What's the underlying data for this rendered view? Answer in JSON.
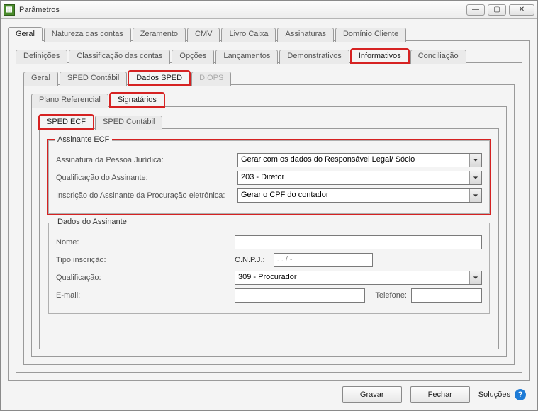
{
  "window": {
    "title": "Parâmetros"
  },
  "tabs_level1": {
    "geral": "Geral",
    "natureza": "Natureza das contas",
    "zeramento": "Zeramento",
    "cmv": "CMV",
    "livro_caixa": "Livro Caixa",
    "assinaturas": "Assinaturas",
    "dominio_cliente": "Domínio Cliente"
  },
  "tabs_level2": {
    "definicoes": "Definições",
    "classificacao": "Classificação das contas",
    "opcoes": "Opções",
    "lancamentos": "Lançamentos",
    "demonstrativos": "Demonstrativos",
    "informativos": "Informativos",
    "conciliacao": "Conciliação"
  },
  "tabs_level3": {
    "geral": "Geral",
    "sped_contabil": "SPED Contábil",
    "dados_sped": "Dados SPED",
    "diops": "DIOPS"
  },
  "tabs_level4": {
    "plano_referencial": "Plano Referencial",
    "signatarios": "Signatários"
  },
  "tabs_level5": {
    "sped_ecf": "SPED ECF",
    "sped_contabil": "SPED Contábil"
  },
  "assinante_ecf": {
    "legend": "Assinante ECF",
    "assinatura_pj_label": "Assinatura da Pessoa Jurídica:",
    "assinatura_pj_value": "Gerar com os dados do Responsável Legal/ Sócio",
    "qualificacao_label": "Qualificação do Assinante:",
    "qualificacao_value": "203 - Diretor",
    "inscricao_label": "Inscrição do Assinante da Procuração eletrônica:",
    "inscricao_value": "Gerar o CPF do contador"
  },
  "dados_assinante": {
    "legend": "Dados do Assinante",
    "nome_label": "Nome:",
    "nome_value": "",
    "tipo_inscricao_label": "Tipo inscrição:",
    "tipo_inscricao_prefix": "C.N.P.J.:",
    "tipo_inscricao_mask": "   .   .   /       -",
    "qualificacao_label": "Qualificação:",
    "qualificacao_value": "309 - Procurador",
    "email_label": "E-mail:",
    "email_value": "",
    "telefone_label": "Telefone:",
    "telefone_value": ""
  },
  "footer": {
    "gravar": "Gravar",
    "fechar": "Fechar",
    "solucoes": "Soluções"
  }
}
